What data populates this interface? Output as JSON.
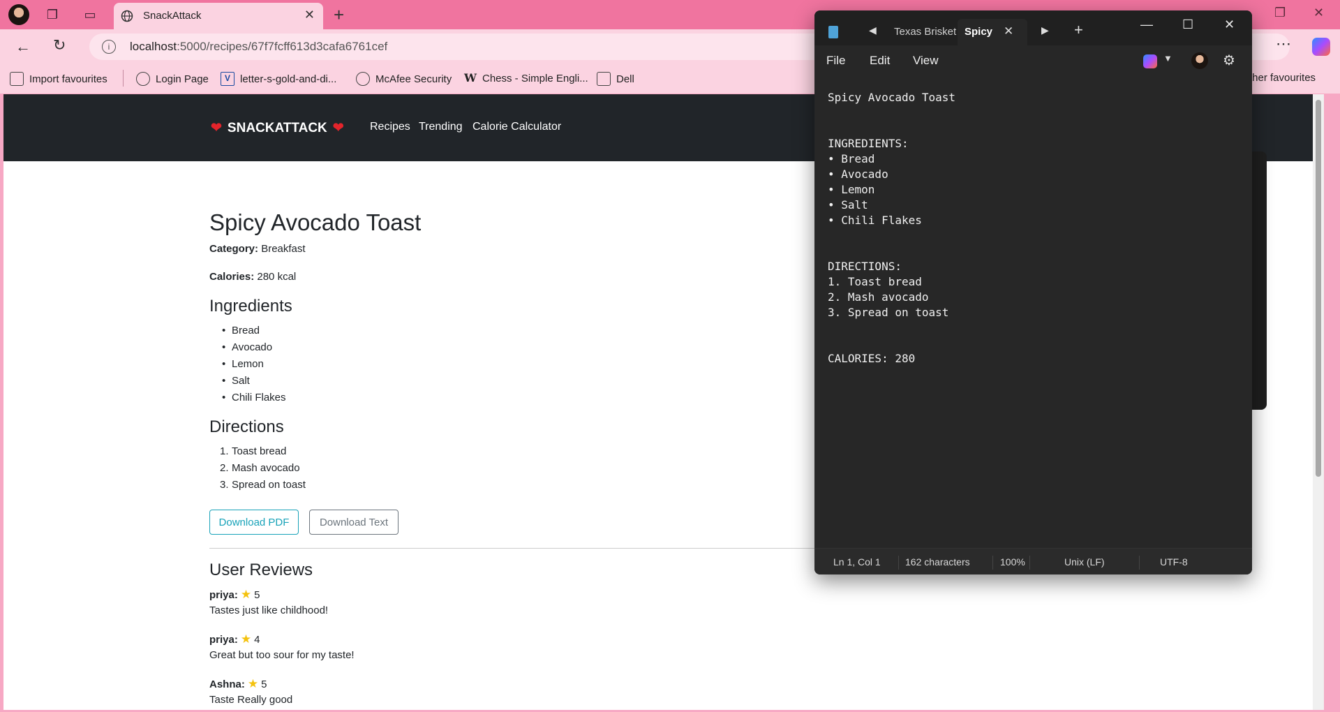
{
  "browser": {
    "tab_title": "SnackAttack",
    "url_host": "localhost",
    "url_path": ":5000/recipes/67f7fcff613d3cafa6761cef",
    "bookmarks": [
      "Import favourites",
      "Login Page",
      "letter-s-gold-and-di...",
      "McAfee Security",
      "Chess - Simple Engli...",
      "Dell"
    ],
    "other_favourites": "ther favourites"
  },
  "site": {
    "brand": "SNACKATTACK",
    "nav": [
      "Recipes",
      "Trending",
      "Calorie Calculator"
    ]
  },
  "recipe": {
    "title": "Spicy Avocado Toast",
    "category_label": "Category:",
    "category": "Breakfast",
    "calories_label": "Calories:",
    "calories": "280 kcal",
    "ingredients_heading": "Ingredients",
    "ingredients": [
      "Bread",
      "Avocado",
      "Lemon",
      "Salt",
      "Chili Flakes"
    ],
    "directions_heading": "Directions",
    "directions": [
      "Toast bread",
      "Mash avocado",
      "Spread on toast"
    ],
    "download_pdf": "Download PDF",
    "download_text": "Download Text"
  },
  "reviews": {
    "heading": "User Reviews",
    "items": [
      {
        "user": "priya:",
        "rating": "5",
        "text": "Tastes just like childhood!"
      },
      {
        "user": "priya:",
        "rating": "4",
        "text": "Great but too sour for my taste!"
      },
      {
        "user": "Ashna:",
        "rating": "5",
        "text": "Taste Really good"
      }
    ]
  },
  "notepad": {
    "tabs": [
      "Texas Brisket",
      "Spicy"
    ],
    "menu": [
      "File",
      "Edit",
      "View"
    ],
    "content": "Spicy Avocado Toast\n\n\nINGREDIENTS:\n• Bread\n• Avocado\n• Lemon\n• Salt\n• Chili Flakes\n\n\nDIRECTIONS:\n1. Toast bread\n2. Mash avocado\n3. Spread on toast\n\n\nCALORIES: 280",
    "status": {
      "position": "Ln 1, Col 1",
      "chars": "162 characters",
      "zoom": "100%",
      "line_ending": "Unix (LF)",
      "encoding": "UTF-8"
    }
  },
  "colors": {
    "tabstrip": "#f0749f",
    "chrome": "#fbd3e1",
    "navbar": "#212529",
    "heart": "#e3242b",
    "star": "#f4c20d",
    "pdf_button": "#17a2b8",
    "text_button": "#6c757d",
    "notepad_bg": "#272727"
  }
}
